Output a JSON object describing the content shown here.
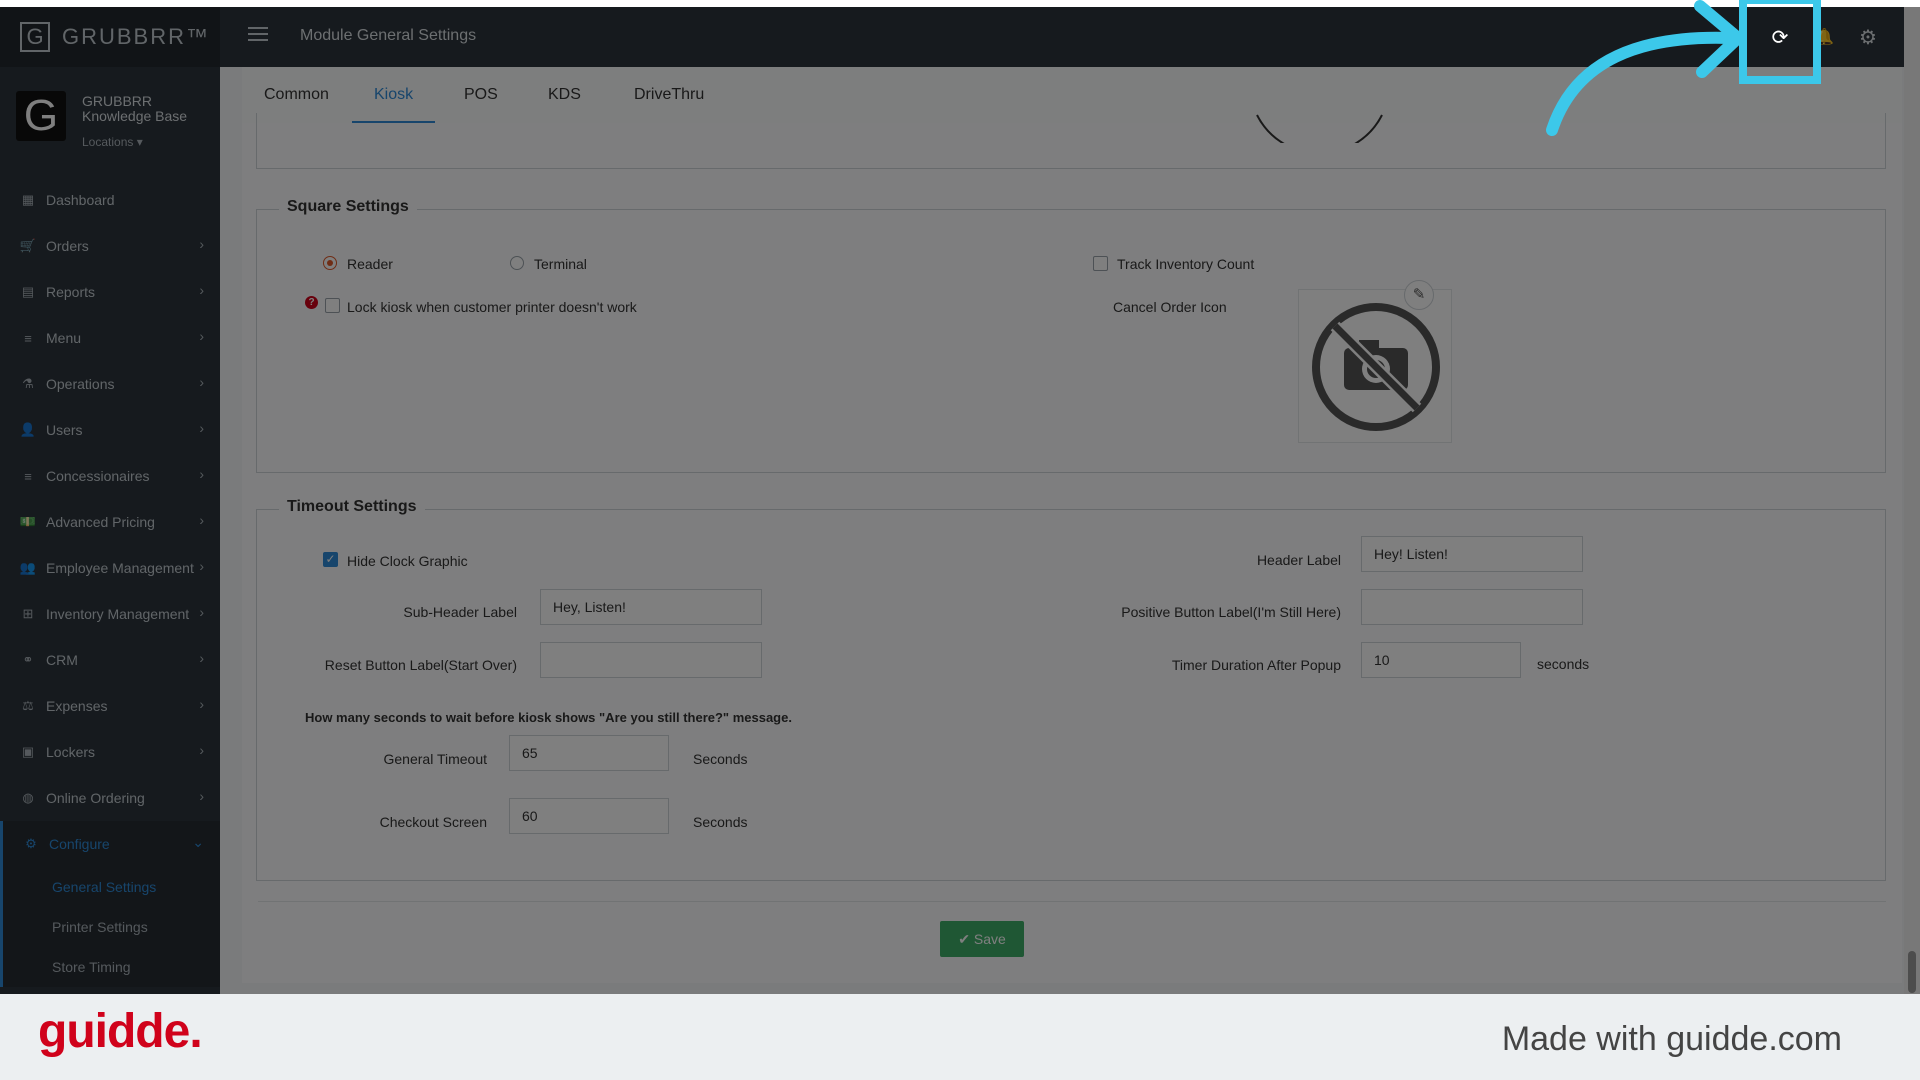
{
  "brand": {
    "logo": "G",
    "name": "GRUBBRR™"
  },
  "profile": {
    "logo": "G",
    "name_line1": "GRUBBRR",
    "name_line2": "Knowledge Base",
    "locations": "Locations ▾"
  },
  "sidebar": {
    "items": [
      {
        "label": "Dashboard",
        "icon": "dashboard-icon",
        "glyph": "▦",
        "chevron": ""
      },
      {
        "label": "Orders",
        "icon": "cart-icon",
        "glyph": "🛒",
        "chevron": "›"
      },
      {
        "label": "Reports",
        "icon": "report-icon",
        "glyph": "▤",
        "chevron": "›"
      },
      {
        "label": "Menu",
        "icon": "menu-list-icon",
        "glyph": "≡",
        "chevron": "›"
      },
      {
        "label": "Operations",
        "icon": "flask-icon",
        "glyph": "⚗",
        "chevron": "›"
      },
      {
        "label": "Users",
        "icon": "users-icon",
        "glyph": "👤",
        "chevron": "›"
      },
      {
        "label": "Concessionaires",
        "icon": "list-icon",
        "glyph": "≡",
        "chevron": "›"
      },
      {
        "label": "Advanced Pricing",
        "icon": "money-icon",
        "glyph": "💵",
        "chevron": "›"
      },
      {
        "label": "Employee Management",
        "icon": "employees-icon",
        "glyph": "👥",
        "chevron": "›"
      },
      {
        "label": "Inventory Management",
        "icon": "sitemap-icon",
        "glyph": "⊞",
        "chevron": "›"
      },
      {
        "label": "CRM",
        "icon": "link-icon",
        "glyph": "⚭",
        "chevron": "›"
      },
      {
        "label": "Expenses",
        "icon": "scale-icon",
        "glyph": "⚖",
        "chevron": "›"
      },
      {
        "label": "Lockers",
        "icon": "locker-icon",
        "glyph": "▣",
        "chevron": "›"
      },
      {
        "label": "Online Ordering",
        "icon": "globe-icon",
        "glyph": "◍",
        "chevron": "›"
      },
      {
        "label": "Configure",
        "icon": "gear-icon",
        "glyph": "⚙",
        "chevron": "⌄"
      }
    ],
    "subitems": [
      "General Settings",
      "Printer Settings",
      "Store Timing"
    ]
  },
  "topbar": {
    "title": "Module General Settings",
    "refresh_glyph": "⟳",
    "bell_glyph": "🔔",
    "gear_glyph": "⚙"
  },
  "tabs": [
    "Common",
    "Kiosk",
    "POS",
    "KDS",
    "DriveThru"
  ],
  "square": {
    "legend": "Square Settings",
    "reader": "Reader",
    "terminal": "Terminal",
    "track_inventory": "Track Inventory Count",
    "lock_kiosk": "Lock kiosk when customer printer doesn't work",
    "cancel_order_icon": "Cancel Order Icon",
    "help": "?",
    "edit": "✎"
  },
  "timeout": {
    "legend": "Timeout Settings",
    "hide_clock": "Hide Clock Graphic",
    "header_label": "Header Label",
    "header_value": "Hey! Listen!",
    "subheader_label": "Sub-Header Label",
    "subheader_value": "Hey, Listen!",
    "positive_label": "Positive Button Label(I'm Still Here)",
    "positive_value": "",
    "reset_label": "Reset Button Label(Start Over)",
    "reset_value": "",
    "timer_label": "Timer Duration After Popup",
    "timer_value": "10",
    "timer_unit": "seconds",
    "question": "How many seconds to wait before kiosk shows \"Are you still there?\" message.",
    "general_label": "General Timeout",
    "general_value": "65",
    "general_unit": "Seconds",
    "checkout_label": "Checkout Screen",
    "checkout_value": "60",
    "checkout_unit": "Seconds",
    "checkmark": "✓"
  },
  "save": "✔ Save",
  "footer": {
    "logo": "guidde.",
    "text": "Made with guidde.com"
  },
  "colors": {
    "accent": "#2e8bd8",
    "highlight": "#3cc8ea",
    "save": "#3fae68",
    "brand_red": "#d0021b"
  }
}
